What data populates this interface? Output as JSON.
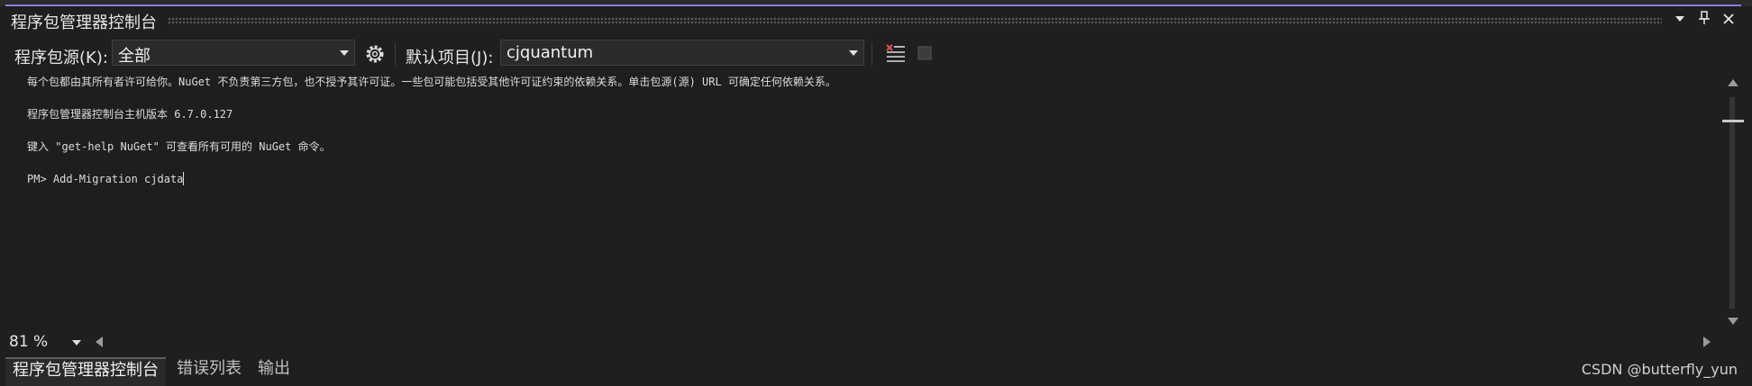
{
  "panel": {
    "title": "程序包管理器控制台"
  },
  "toolbar": {
    "source_label": "程序包源(K):",
    "source_value": "全部",
    "project_label": "默认项目(J):",
    "project_value": "cjquantum"
  },
  "console": {
    "lines": [
      "每个包都由其所有者许可给你。NuGet 不负责第三方包，也不授予其许可证。一些包可能包括受其他许可证约束的依赖关系。单击包源(源) URL 可确定任何依赖关系。",
      "程序包管理器控制台主机版本 6.7.0.127",
      "键入 \"get-help NuGet\" 可查看所有可用的 NuGet 命令。",
      "PM> Add-Migration cjdata"
    ]
  },
  "zoom": {
    "value": "81 %"
  },
  "tabs": [
    {
      "label": "程序包管理器控制台",
      "active": true
    },
    {
      "label": "错误列表",
      "active": false
    },
    {
      "label": "输出",
      "active": false
    }
  ],
  "watermark": "CSDN @butterfly_yun",
  "icons": {
    "settings": "gear-icon",
    "clear": "clear-console-icon",
    "stop": "stop-icon",
    "dropdown": "chevron-down-icon",
    "pin": "pin-icon",
    "close": "close-icon"
  },
  "colors": {
    "accent": "#8b7cd9",
    "background": "#1f1f1f",
    "clear_icon_red": "#e05252"
  }
}
